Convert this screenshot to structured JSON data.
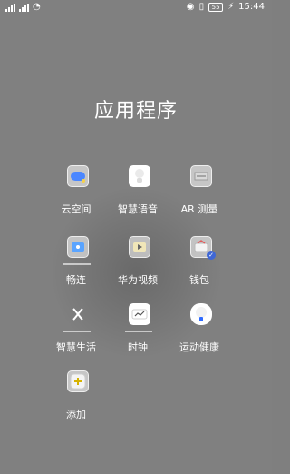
{
  "status_bar": {
    "time": "15:44",
    "battery": "55",
    "icons": [
      "signal-icon",
      "wifi-icon",
      "eye-icon",
      "vibrate-icon",
      "battery-icon",
      "charging-icon"
    ]
  },
  "title": "应用程序",
  "apps": [
    {
      "name": "云空间",
      "icon": "cloud-space-icon"
    },
    {
      "name": "智慧语音",
      "icon": "smart-voice-icon"
    },
    {
      "name": "AR 测量",
      "icon": "ar-measure-icon"
    },
    {
      "name": "畅连",
      "icon": "meetime-icon"
    },
    {
      "name": "华为视频",
      "icon": "huawei-video-icon"
    },
    {
      "name": "钱包",
      "icon": "wallet-icon"
    },
    {
      "name": "智慧生活",
      "icon": "smart-life-icon"
    },
    {
      "name": "时钟",
      "icon": "clock-icon"
    },
    {
      "name": "运动健康",
      "icon": "health-icon"
    },
    {
      "name": "添加",
      "icon": "add-icon"
    }
  ]
}
